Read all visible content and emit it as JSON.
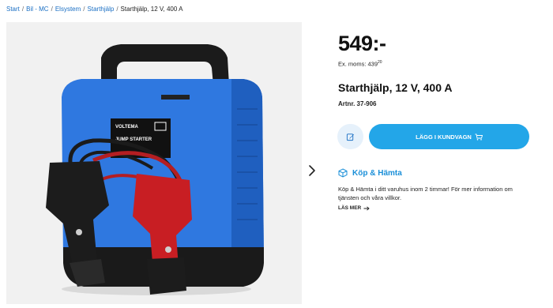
{
  "breadcrumb": {
    "items": [
      "Start",
      "Bil - MC",
      "Elsystem",
      "Starthjälp"
    ],
    "current": "Starthjälp, 12 V, 400 A"
  },
  "product": {
    "price": "549:-",
    "ex_moms_label": "Ex. moms:",
    "ex_moms_value": "439",
    "ex_moms_cents": "20",
    "title": "Starthjälp, 12 V, 400 A",
    "artnr": "Artnr. 37-906",
    "image_label_brand": "VOLTEMA",
    "image_label_text": "JUMP STARTER"
  },
  "actions": {
    "add_to_cart": "LÄGG I KUNDVAGN"
  },
  "pickup": {
    "title": "Köp & Hämta",
    "text": "Köp & Hämta i ditt varuhus inom 2 timmar! För mer information om tjänsten och våra villkor.",
    "read_more": "LÄS MER"
  },
  "colors": {
    "accent": "#23a6e8",
    "link": "#1a6fc4",
    "pickup_title": "#1a8fd8",
    "device_blue": "#2f78e0"
  }
}
